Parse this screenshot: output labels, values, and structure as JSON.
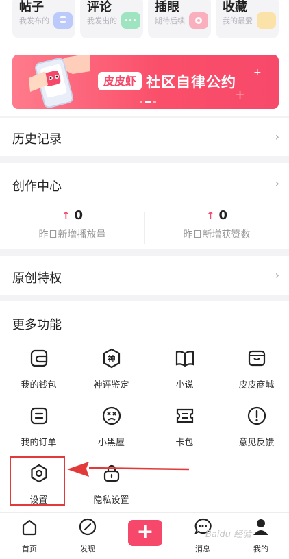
{
  "quick_cards": [
    {
      "title": "帖子",
      "sub": "我发布的",
      "color": "#6a8cff"
    },
    {
      "title": "评论",
      "sub": "我发出的",
      "color": "#32c77a"
    },
    {
      "title": "插眼",
      "sub": "期待后续",
      "color": "#ff5a78"
    },
    {
      "title": "收藏",
      "sub": "我的最爱",
      "color": "#ffc43a"
    }
  ],
  "banner": {
    "tag": "皮皮虾",
    "title": "社区自律公约"
  },
  "history": {
    "title": "历史记录"
  },
  "creation": {
    "title": "创作中心",
    "stats": [
      {
        "value": "0",
        "label": "昨日新增播放量"
      },
      {
        "value": "0",
        "label": "昨日新增获赞数"
      }
    ]
  },
  "original": {
    "title": "原创特权"
  },
  "more": {
    "title": "更多功能",
    "items": [
      {
        "label": "我的钱包",
        "icon": "wallet-icon"
      },
      {
        "label": "神评鉴定",
        "icon": "shen-badge-icon"
      },
      {
        "label": "小说",
        "icon": "book-icon"
      },
      {
        "label": "皮皮商城",
        "icon": "shop-icon"
      },
      {
        "label": "我的订单",
        "icon": "order-icon"
      },
      {
        "label": "小黑屋",
        "icon": "blackroom-face-icon"
      },
      {
        "label": "卡包",
        "icon": "card-icon"
      },
      {
        "label": "意见反馈",
        "icon": "feedback-icon"
      },
      {
        "label": "设置",
        "icon": "settings-hex-icon"
      },
      {
        "label": "隐私设置",
        "icon": "lock-icon"
      }
    ]
  },
  "tabbar": {
    "items": [
      {
        "label": "首页",
        "icon": "home-icon"
      },
      {
        "label": "发现",
        "icon": "compass-icon"
      },
      {
        "label": "",
        "icon": "plus-icon"
      },
      {
        "label": "消息",
        "icon": "chat-icon"
      },
      {
        "label": "我的",
        "icon": "profile-icon"
      }
    ],
    "add": "+"
  },
  "watermark": "Baidu 经验",
  "accent": "#f5486a",
  "annotation_color": "#e23a3a"
}
